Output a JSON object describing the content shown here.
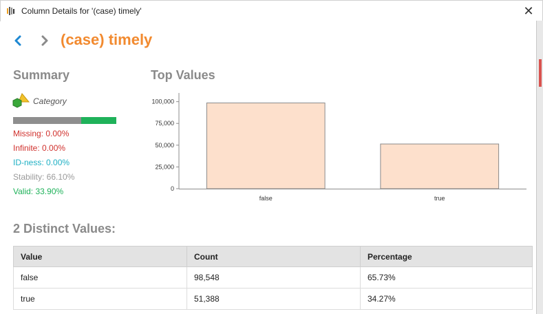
{
  "window": {
    "title": "Column Details for '(case) timely'",
    "close_label": "✕"
  },
  "header": {
    "title": "(case) timely"
  },
  "summary": {
    "heading": "Summary",
    "type_label": "Category",
    "valid_fraction": 0.339,
    "stats": {
      "missing": "Missing: 0.00%",
      "infinite": "Infinite: 0.00%",
      "idness": "ID-ness: 0.00%",
      "stability": "Stability: 66.10%",
      "valid": "Valid: 33.90%"
    },
    "colors": {
      "missing": "#d0312d",
      "idness": "#1fb0c4",
      "stability": "#9a9a9a",
      "valid": "#1fb25a"
    }
  },
  "top_values": {
    "heading": "Top Values"
  },
  "chart_data": {
    "type": "bar",
    "categories": [
      "false",
      "true"
    ],
    "values": [
      98548,
      51388
    ],
    "ylim": [
      0,
      110000
    ],
    "yticks": [
      0,
      25000,
      50000,
      75000,
      100000
    ],
    "ytick_labels": [
      "0",
      "25,000",
      "50,000",
      "75,000",
      "100,000"
    ],
    "bar_color": "#fde0cc",
    "grid": false
  },
  "distinct": {
    "heading": "2 Distinct Values:",
    "columns": [
      "Value",
      "Count",
      "Percentage"
    ],
    "rows": [
      [
        "false",
        "98,548",
        "65.73%"
      ],
      [
        "true",
        "51,388",
        "34.27%"
      ]
    ]
  }
}
